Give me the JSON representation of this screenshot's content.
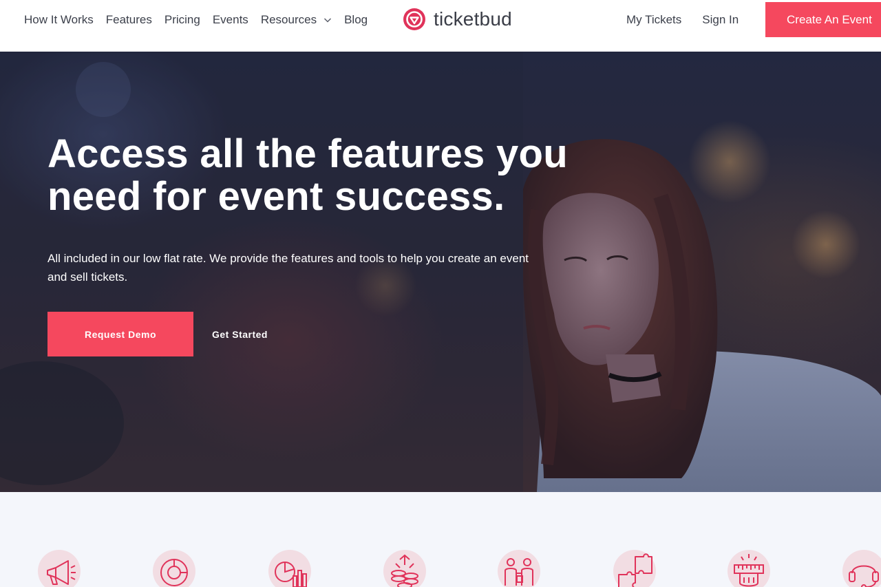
{
  "header": {
    "nav_left": [
      {
        "label": "How It Works"
      },
      {
        "label": "Features"
      },
      {
        "label": "Pricing"
      },
      {
        "label": "Events"
      },
      {
        "label": "Resources",
        "icon": "chevron-down-icon"
      },
      {
        "label": "Blog"
      }
    ],
    "logo_text": "ticketbud",
    "nav_right": [
      {
        "label": "My Tickets"
      },
      {
        "label": "Sign In"
      }
    ],
    "cta_label": "Create An Event"
  },
  "hero": {
    "title": "Access all the features you need for event success.",
    "subtitle": "All included in our low flat rate. We provide the features and tools to help you create an event and sell tickets.",
    "primary_button": "Request Demo",
    "secondary_button": "Get Started"
  },
  "feature_icons": [
    {
      "icon": "megaphone-icon"
    },
    {
      "icon": "donut-chart-icon"
    },
    {
      "icon": "analytics-chart-icon"
    },
    {
      "icon": "coins-icon"
    },
    {
      "icon": "team-icon"
    },
    {
      "icon": "puzzle-icon"
    },
    {
      "icon": "ruler-hand-icon"
    },
    {
      "icon": "headset-icon"
    }
  ],
  "colors": {
    "accent": "#f5485e",
    "icon_stroke": "#e0335a",
    "icon_bg": "#f2dde3",
    "text_dark": "#3b3f4a",
    "hero_bg": "#262a3e",
    "section_bg": "#f4f6fb"
  }
}
